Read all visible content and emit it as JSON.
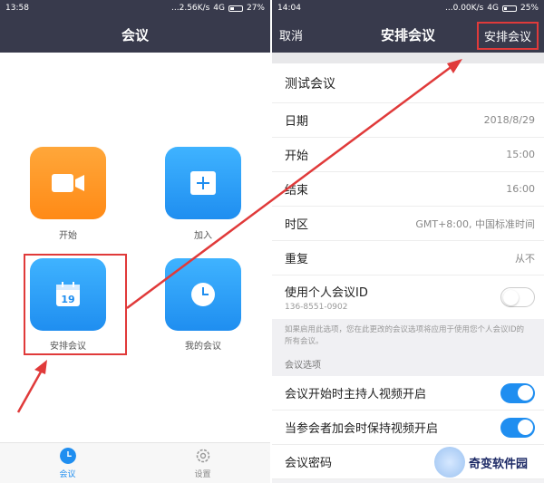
{
  "left": {
    "status": {
      "time": "13:58",
      "net": "...2.56K/s",
      "signal": "4G",
      "battery": "27%"
    },
    "title": "会议",
    "tiles": [
      {
        "label": "开始",
        "icon": "video-camera-icon",
        "color": "#ff8a16"
      },
      {
        "label": "加入",
        "icon": "plus-icon",
        "color": "#1f8ef0"
      },
      {
        "label": "安排会议",
        "icon": "calendar-icon",
        "calendar_day": "19",
        "color": "#1f8ef0"
      },
      {
        "label": "我的会议",
        "icon": "clock-icon",
        "color": "#1f8ef0"
      }
    ],
    "tabs": [
      {
        "label": "会议",
        "icon": "clock-icon",
        "active": true
      },
      {
        "label": "设置",
        "icon": "gear-icon",
        "active": false
      }
    ]
  },
  "right": {
    "status": {
      "time": "14:04",
      "net": "...0.00K/s",
      "signal": "4G",
      "battery": "25%"
    },
    "cancel": "取消",
    "title": "安排会议",
    "action": "安排会议",
    "topic": "测试会议",
    "rows": [
      {
        "label": "日期",
        "value": "2018/8/29"
      },
      {
        "label": "开始",
        "value": "15:00"
      },
      {
        "label": "结束",
        "value": "16:00"
      },
      {
        "label": "时区",
        "value": "GMT+8:00, 中国标准时间"
      },
      {
        "label": "重复",
        "value": "从不"
      }
    ],
    "pmi": {
      "label": "使用个人会议ID",
      "id": "136-8551-0902",
      "enabled": false
    },
    "note": "如果启用此选项，您在此更改的会议选项将应用于使用您个人会议ID的所有会议。",
    "section_title": "会议选项",
    "options": [
      {
        "label": "会议开始时主持人视频开启",
        "enabled": true
      },
      {
        "label": "当参会者加会时保持视频开启",
        "enabled": true
      },
      {
        "label": "会议密码",
        "enabled": null
      }
    ]
  },
  "watermark": "奇变软件园",
  "colors": {
    "nav": "#383a4c",
    "accent": "#1f8ef0",
    "orange": "#ff8a16",
    "highlight": "#e03a3a"
  }
}
